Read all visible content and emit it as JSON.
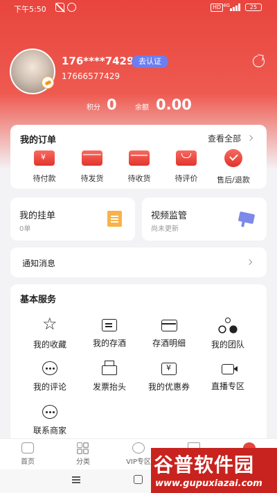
{
  "status_bar": {
    "time": "下午5:50",
    "network_hd": "HD",
    "network_type": "4G",
    "battery": "25"
  },
  "profile": {
    "phone_masked": "176****7429",
    "verify_label": "去认证",
    "phone_full": "17666577429",
    "points_label": "积分",
    "points_value": "0",
    "balance_label": "余额",
    "balance_value": "0.00"
  },
  "orders": {
    "title": "我的订单",
    "view_all": "查看全部",
    "items": [
      {
        "label": "待付款",
        "icon": "wallet-icon"
      },
      {
        "label": "待发货",
        "icon": "package-icon"
      },
      {
        "label": "待收货",
        "icon": "box-icon"
      },
      {
        "label": "待评价",
        "icon": "bag-icon"
      },
      {
        "label": "售后/退款",
        "icon": "check-icon"
      }
    ]
  },
  "pending": {
    "title": "我的挂单",
    "subtitle": "0单"
  },
  "monitor": {
    "title": "视频监管",
    "subtitle": "尚未更新"
  },
  "notify": {
    "title": "通知消息"
  },
  "services": {
    "title": "基本服务",
    "items": [
      {
        "label": "我的收藏",
        "icon": "star-icon"
      },
      {
        "label": "我的存酒",
        "icon": "storage-icon"
      },
      {
        "label": "存酒明细",
        "icon": "card-icon"
      },
      {
        "label": "我的团队",
        "icon": "team-icon"
      },
      {
        "label": "我的评论",
        "icon": "comment-icon"
      },
      {
        "label": "发票抬头",
        "icon": "printer-icon"
      },
      {
        "label": "我的优惠券",
        "icon": "coupon-icon"
      },
      {
        "label": "直播专区",
        "icon": "video-icon"
      },
      {
        "label": "联系商家",
        "icon": "chat-icon"
      }
    ]
  },
  "tabbar": {
    "items": [
      {
        "label": "首页",
        "icon": "home-icon"
      },
      {
        "label": "分类",
        "icon": "grid-icon"
      },
      {
        "label": "VIP专区",
        "icon": "vip-icon"
      },
      {
        "label": "",
        "icon": "cart-icon"
      },
      {
        "label": "",
        "icon": "profile-icon"
      }
    ]
  },
  "watermark": {
    "brand": "谷普软件园",
    "url": "www.gupuxiazai.com"
  },
  "colors": {
    "primary": "#e8453e",
    "verify": "#6c7ef0",
    "note": "#f7b24a",
    "camera": "#7d89e8"
  }
}
